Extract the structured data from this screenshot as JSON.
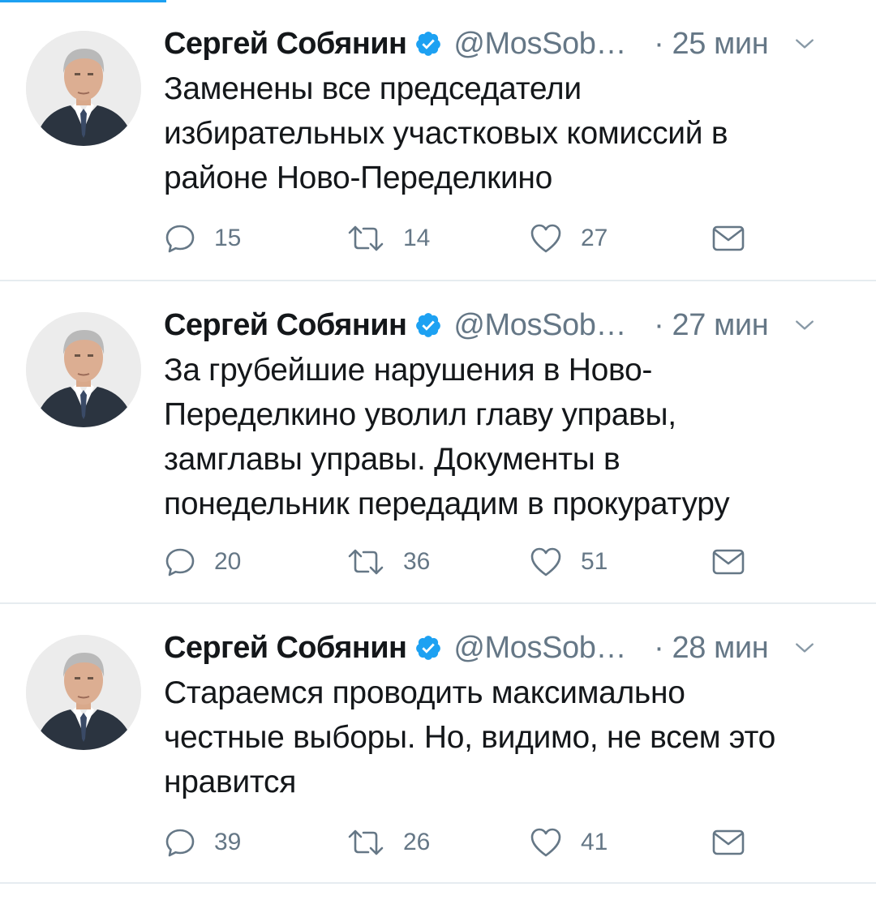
{
  "tweets": [
    {
      "author": "Сергей Собянин",
      "handle": "@MosSob…",
      "time": "· 25 мин",
      "text": "Заменены все председатели\nизбирательных участковых комиссий в\nрайоне Ново-Переделкино",
      "replies": "15",
      "retweets": "14",
      "likes": "27"
    },
    {
      "author": "Сергей Собянин",
      "handle": "@MosSob…",
      "time": "· 27 мин",
      "text": "За грубейшие нарушения в Ново-\nПеределкино уволил главу управы,\nзамглавы управы. Документы в\nпонедельник передадим в прокуратуру",
      "replies": "20",
      "retweets": "36",
      "likes": "51"
    },
    {
      "author": "Сергей Собянин",
      "handle": "@MosSob…",
      "time": "· 28 мин",
      "text": "Стараемся проводить максимально\nчестные выборы. Но, видимо, не всем это\nнравится",
      "replies": "39",
      "retweets": "26",
      "likes": "41"
    }
  ],
  "colors": {
    "accent": "#1da1f2",
    "text": "#14171a",
    "secondary": "#657786",
    "divider": "#e6ecf0"
  },
  "icons": [
    "verified-badge-icon",
    "caret-down-icon",
    "reply-icon",
    "retweet-icon",
    "like-icon",
    "direct-message-icon"
  ]
}
